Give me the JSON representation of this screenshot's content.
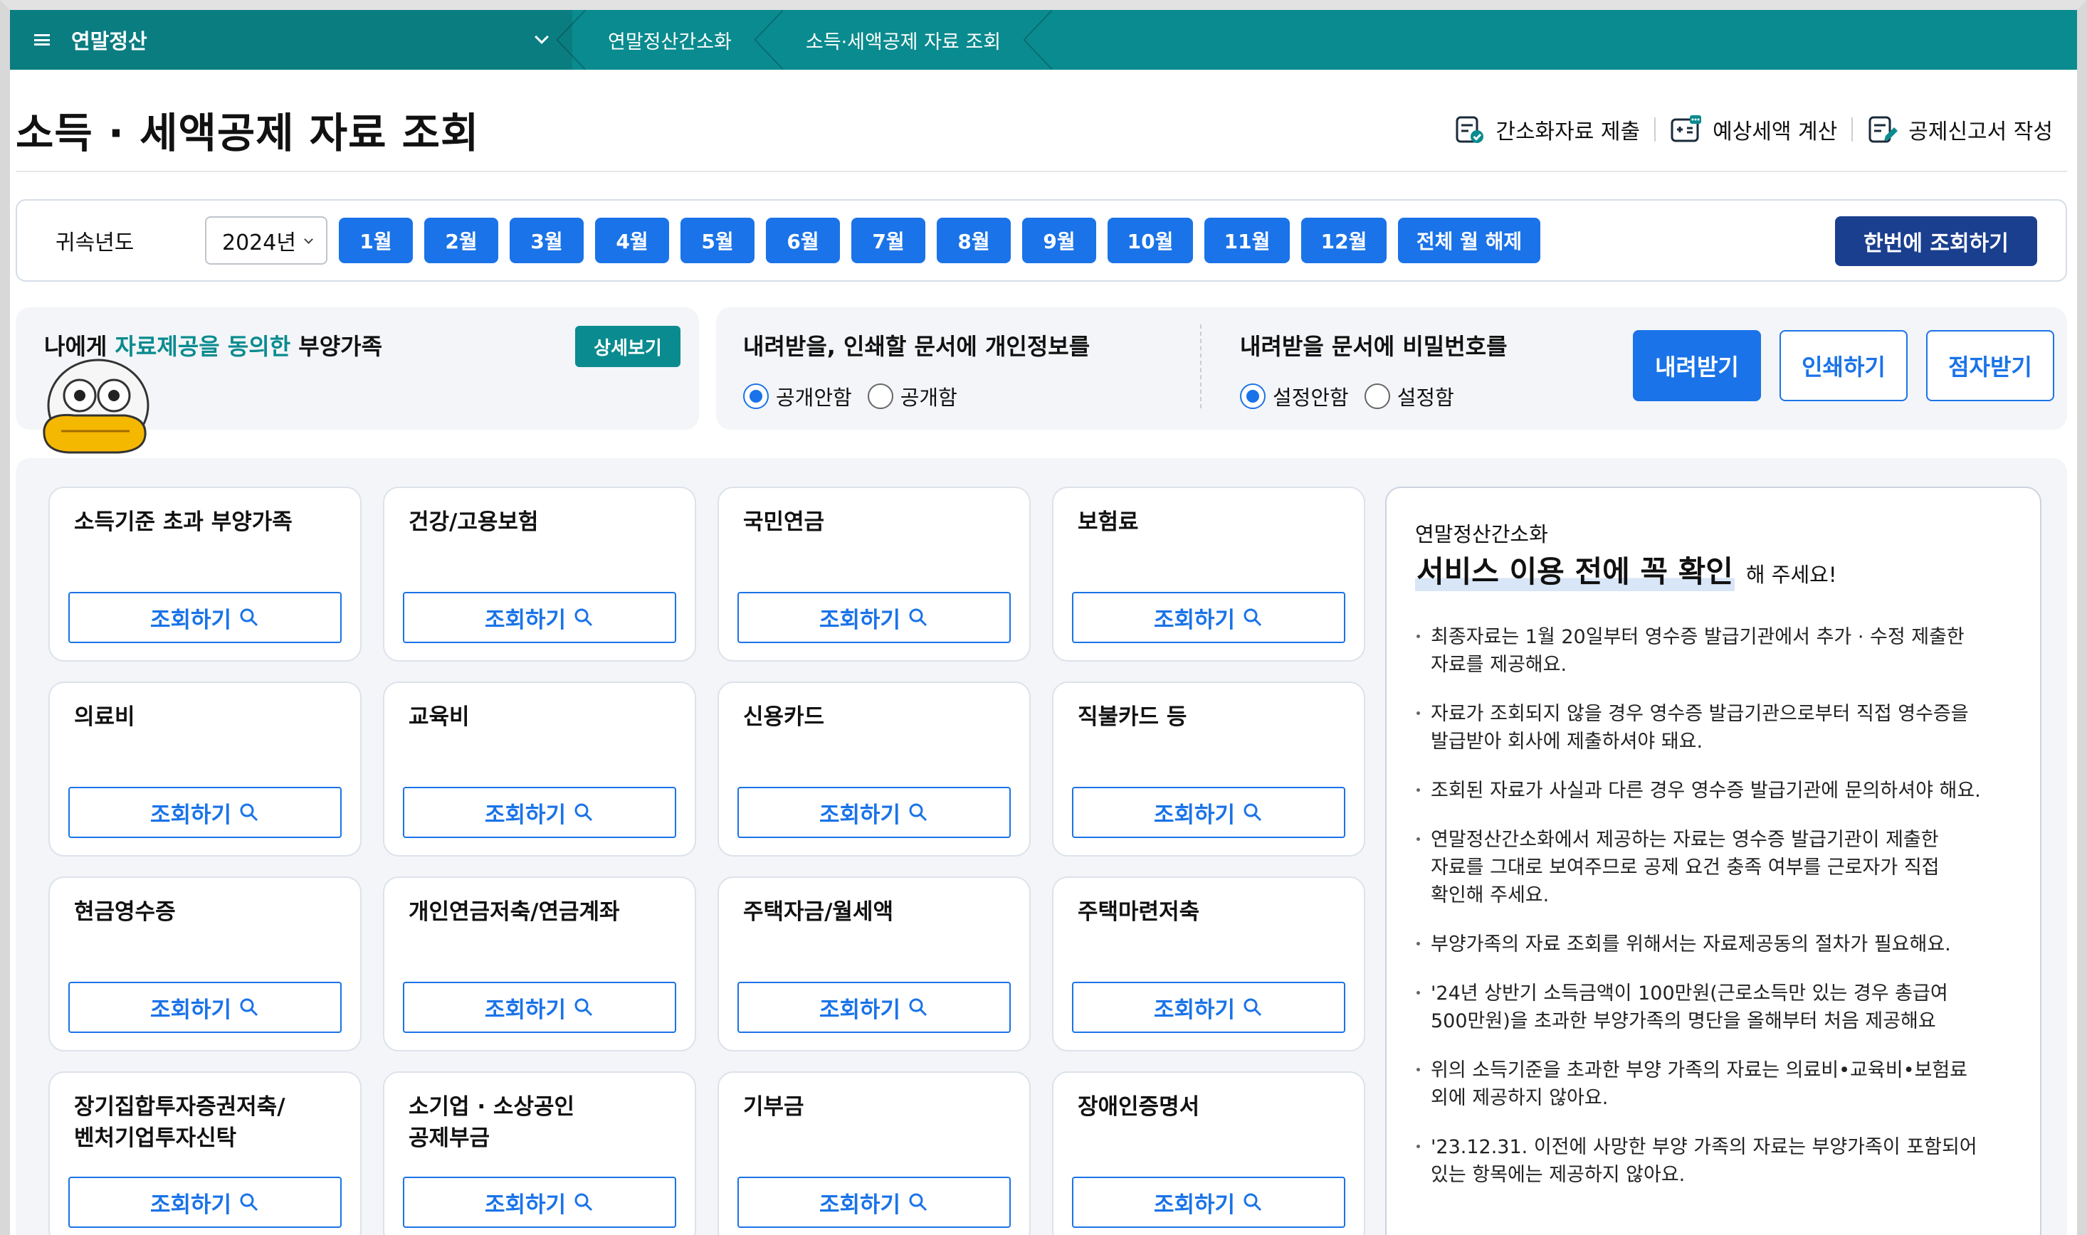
{
  "nav": {
    "menu_title": "연말정산",
    "breadcrumbs": [
      "연말정산간소화",
      "소득·세액공제 자료 조회"
    ]
  },
  "page": {
    "title": "소득 · 세액공제 자료 조회",
    "quick_links": [
      {
        "label": "간소화자료 제출",
        "icon": "document-check-icon"
      },
      {
        "label": "예상세액 계산",
        "icon": "calculator-icon"
      },
      {
        "label": "공제신고서 작성",
        "icon": "document-edit-icon"
      }
    ]
  },
  "filter": {
    "label": "귀속년도",
    "year": "2024년",
    "months": [
      "1월",
      "2월",
      "3월",
      "4월",
      "5월",
      "6월",
      "7월",
      "8월",
      "9월",
      "10월",
      "11월",
      "12월"
    ],
    "clear_all": "전체 월 해제",
    "inquire_all": "한번에 조회하기"
  },
  "consent": {
    "title_prefix": "나에게 ",
    "title_highlight": "자료제공을 동의한",
    "title_suffix": " 부양가족",
    "detail_button": "상세보기"
  },
  "doc_options": {
    "privacy": {
      "title": "내려받을, 인쇄할 문서에 개인정보를",
      "options": [
        "공개안함",
        "공개함"
      ],
      "selected": 0
    },
    "password": {
      "title": "내려받을 문서에 비밀번호를",
      "options": [
        "설정안함",
        "설정함"
      ],
      "selected": 0
    },
    "actions": [
      "내려받기",
      "인쇄하기",
      "점자받기"
    ]
  },
  "cards": {
    "button_label": "조회하기",
    "items": [
      "소득기준 초과 부양가족",
      "건강/고용보험",
      "국민연금",
      "보험료",
      "의료비",
      "교육비",
      "신용카드",
      "직불카드 등",
      "현금영수증",
      "개인연금저축/연금계좌",
      "주택자금/월세액",
      "주택마련저축",
      "장기집합투자증권저축/\n벤처기업투자신탁",
      "소기업 · 소상공인\n공제부금",
      "기부금",
      "장애인증명서"
    ]
  },
  "notice": {
    "subtitle": "연말정산간소화",
    "headline": "서비스 이용 전에 꼭 확인",
    "headline_suffix": "해 주세요!",
    "items": [
      "최종자료는 1월 20일부터 영수증 발급기관에서 추가 · 수정 제출한\n자료를 제공해요.",
      "자료가 조회되지 않을 경우 영수증 발급기관으로부터 직접 영수증을\n발급받아 회사에 제출하셔야 돼요.",
      "조회된 자료가 사실과 다른 경우 영수증 발급기관에 문의하셔야 해요.",
      "연말정산간소화에서 제공하는 자료는 영수증 발급기관이 제출한\n자료를 그대로 보여주므로 공제 요건 충족 여부를 근로자가 직접\n확인해 주세요.",
      "부양가족의 자료 조회를 위해서는 자료제공동의 절차가 필요해요.",
      "'24년 상반기 소득금액이 100만원(근로소득만 있는 경우 총급여\n500만원)을 초과한 부양가족의 명단을 올해부터 처음 제공해요",
      "위의 소득기준을 초과한 부양 가족의 자료는 의료비•교육비•보험료\n외에 제공하지 않아요.",
      "'23.12.31. 이전에 사망한 부양 가족의 자료는 부양가족이 포함되어\n있는 항목에는 제공하지 않아요."
    ]
  },
  "colors": {
    "nav_teal": "#0a8b8f",
    "primary_blue": "#1a73e8",
    "dark_navy": "#1a3f8f"
  }
}
